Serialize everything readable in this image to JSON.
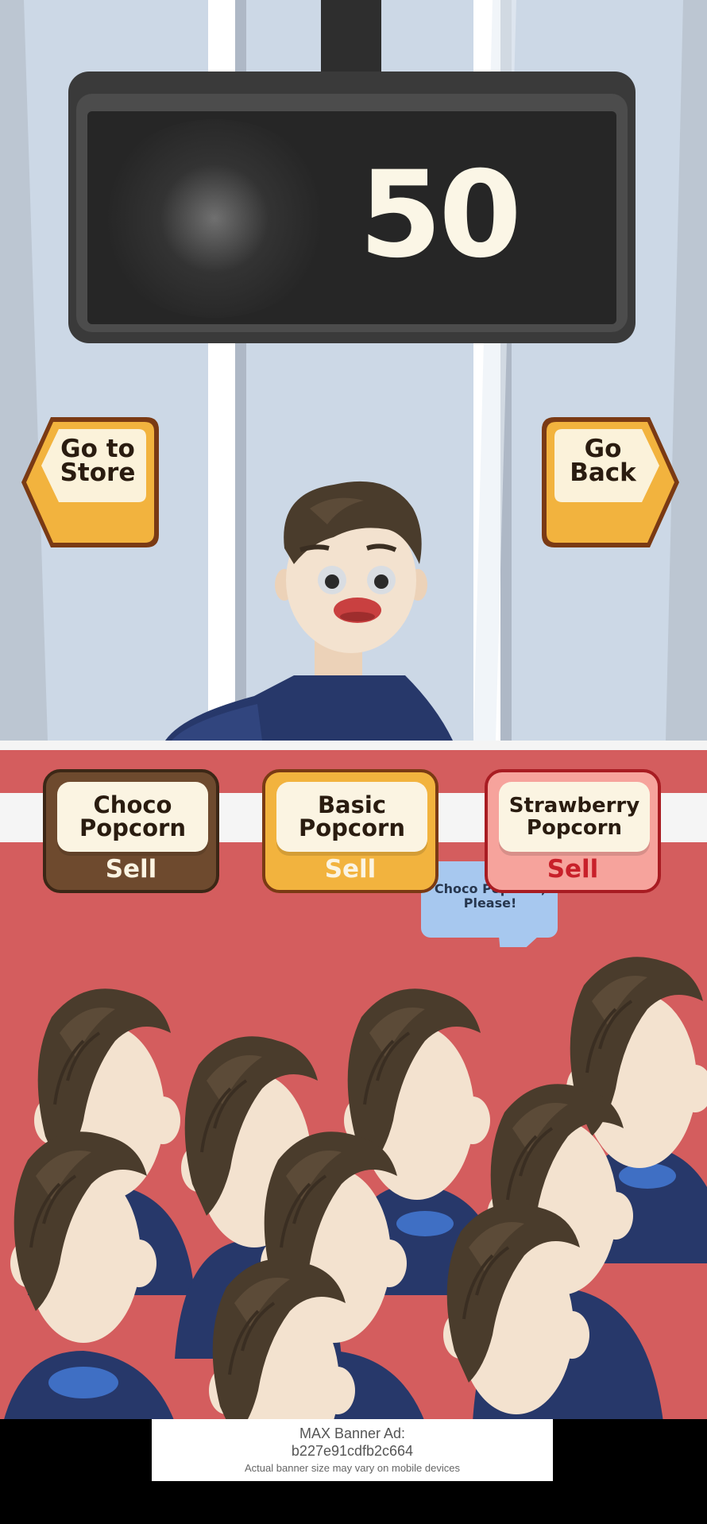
{
  "scoreboard": {
    "value": "50"
  },
  "nav": {
    "store_label": "Go to\nStore",
    "back_label": "Go\nBack"
  },
  "products": [
    {
      "name": "Choco\nPopcorn",
      "action": "Sell",
      "color": "#6e4a2e"
    },
    {
      "name": "Basic\nPopcorn",
      "action": "Sell",
      "color": "#f2b33e"
    },
    {
      "name": "Strawberry\nPopcorn",
      "action": "Sell",
      "color": "#f6a39c"
    }
  ],
  "speech_bubble": {
    "text": "Choco Popcorn,\nPlease!"
  },
  "ad_banner": {
    "line1": "MAX Banner Ad:",
    "line2": "b227e91cdfb2c664",
    "line3": "Actual banner size may vary on mobile devices"
  },
  "colors": {
    "wall": "#ccd8e6",
    "counter": "#d45d5e",
    "button_yellow": "#f2b33e",
    "button_outline": "#7a3a14",
    "shirt": "#27386a",
    "hair": "#4a3c2c",
    "skin": "#f3e2cf"
  }
}
